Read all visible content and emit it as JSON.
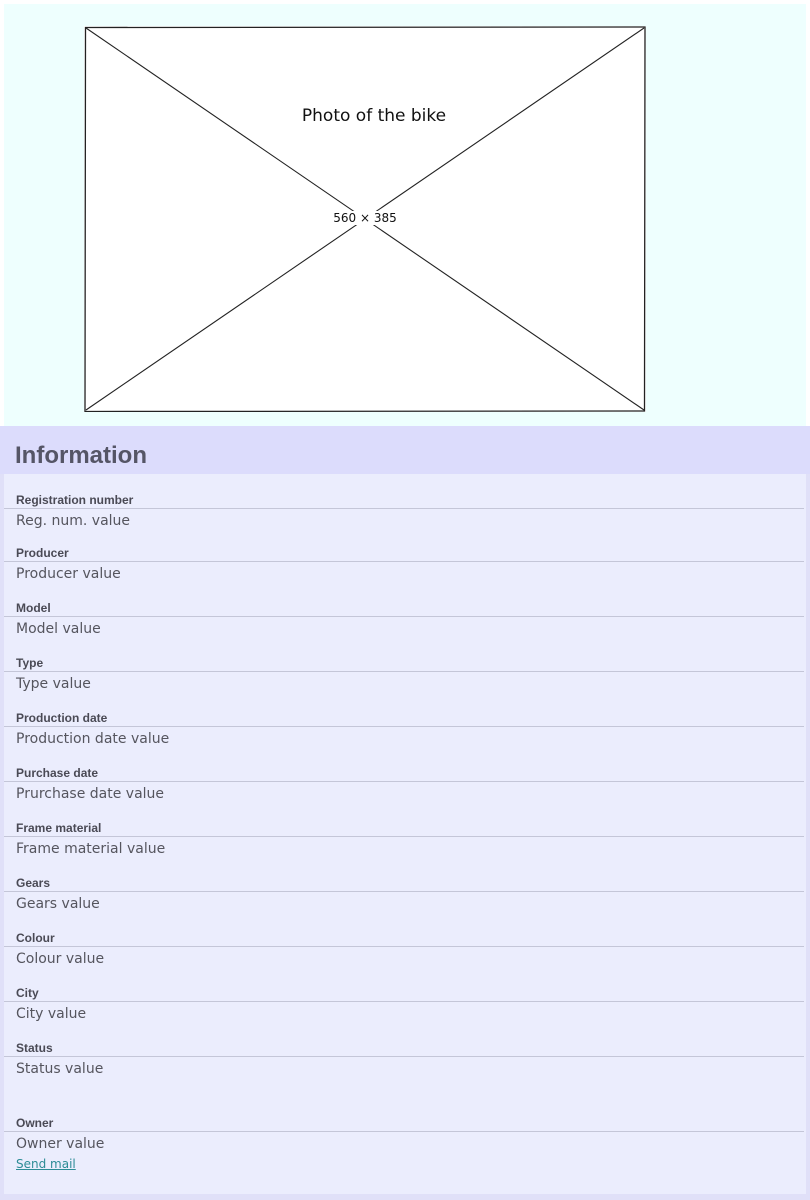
{
  "photo": {
    "caption": "Photo of the bike",
    "dimensions": "560 × 385"
  },
  "info": {
    "title": "Information",
    "fields": [
      {
        "label": "Registration number",
        "value": "Reg. num. value"
      },
      {
        "label": "Producer",
        "value": "Producer value"
      },
      {
        "label": "Model",
        "value": "Model value"
      },
      {
        "label": "Type",
        "value": "Type value"
      },
      {
        "label": "Production date",
        "value": "Production date value"
      },
      {
        "label": "Purchase date",
        "value": "Prurchase date value"
      },
      {
        "label": "Frame material",
        "value": "Frame material value"
      },
      {
        "label": "Gears",
        "value": "Gears value"
      },
      {
        "label": "Colour",
        "value": "Colour value"
      },
      {
        "label": "City",
        "value": "City value"
      },
      {
        "label": "Status",
        "value": "Status value"
      },
      {
        "label": "Owner",
        "value": "Owner value"
      }
    ],
    "send_mail_label": "Send mail"
  },
  "colors": {
    "photo_background": "#eefffe",
    "info_header": "#dcdcfc",
    "info_body": "#ebedfd",
    "link": "#2d8c96"
  }
}
